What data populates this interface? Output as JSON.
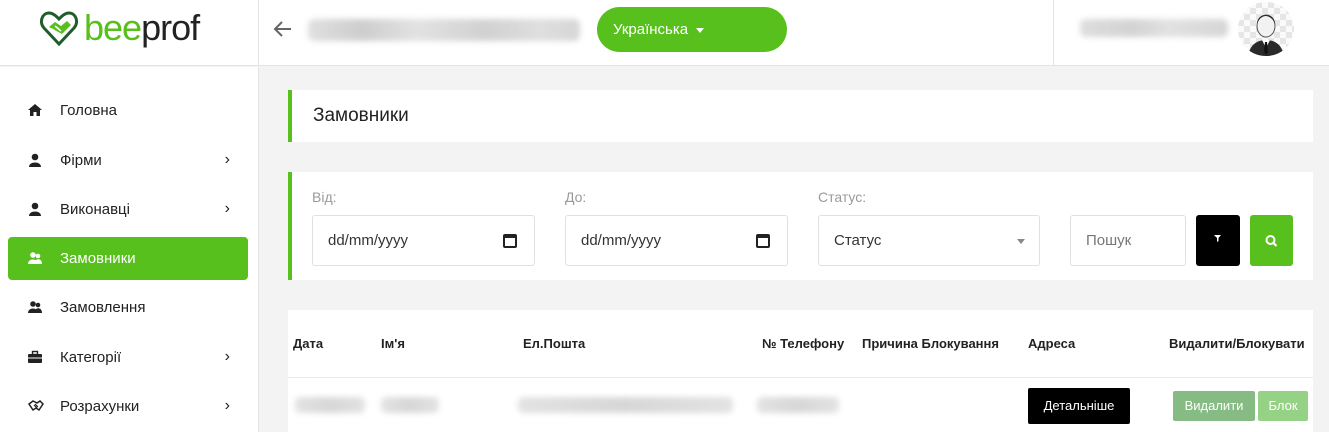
{
  "brand": {
    "name_part1": "bee",
    "name_part2": "prof",
    "color": "#57c01c"
  },
  "header": {
    "language": "Українська"
  },
  "sidebar": {
    "items": [
      {
        "label": "Головна",
        "icon": "home-icon",
        "has_submenu": false,
        "active": false
      },
      {
        "label": "Фірми",
        "icon": "user-icon",
        "has_submenu": true,
        "active": false
      },
      {
        "label": "Виконавці",
        "icon": "user-icon",
        "has_submenu": true,
        "active": false
      },
      {
        "label": "Замовники",
        "icon": "users-icon",
        "has_submenu": false,
        "active": true
      },
      {
        "label": "Замовлення",
        "icon": "users-icon",
        "has_submenu": false,
        "active": false
      },
      {
        "label": "Категорії",
        "icon": "briefcase-icon",
        "has_submenu": true,
        "active": false
      },
      {
        "label": "Розрахунки",
        "icon": "handshake-icon",
        "has_submenu": true,
        "active": false
      }
    ]
  },
  "page": {
    "title": "Замовники"
  },
  "filters": {
    "from_label": "Від:",
    "from_value": "dd/mm/yyyy",
    "to_label": "До:",
    "to_value": "dd/mm/yyyy",
    "status_label": "Статус:",
    "status_value": "Статус",
    "search_placeholder": "Пошук"
  },
  "table": {
    "columns": [
      "Дата",
      "Ім'я",
      "Ел.Пошта",
      "№ Телефону",
      "Причина Блокування",
      "Адреса",
      "Видалити/Блокувати"
    ],
    "row": {
      "details": "Детальніше",
      "delete": "Видалити",
      "block": "Блок"
    }
  }
}
